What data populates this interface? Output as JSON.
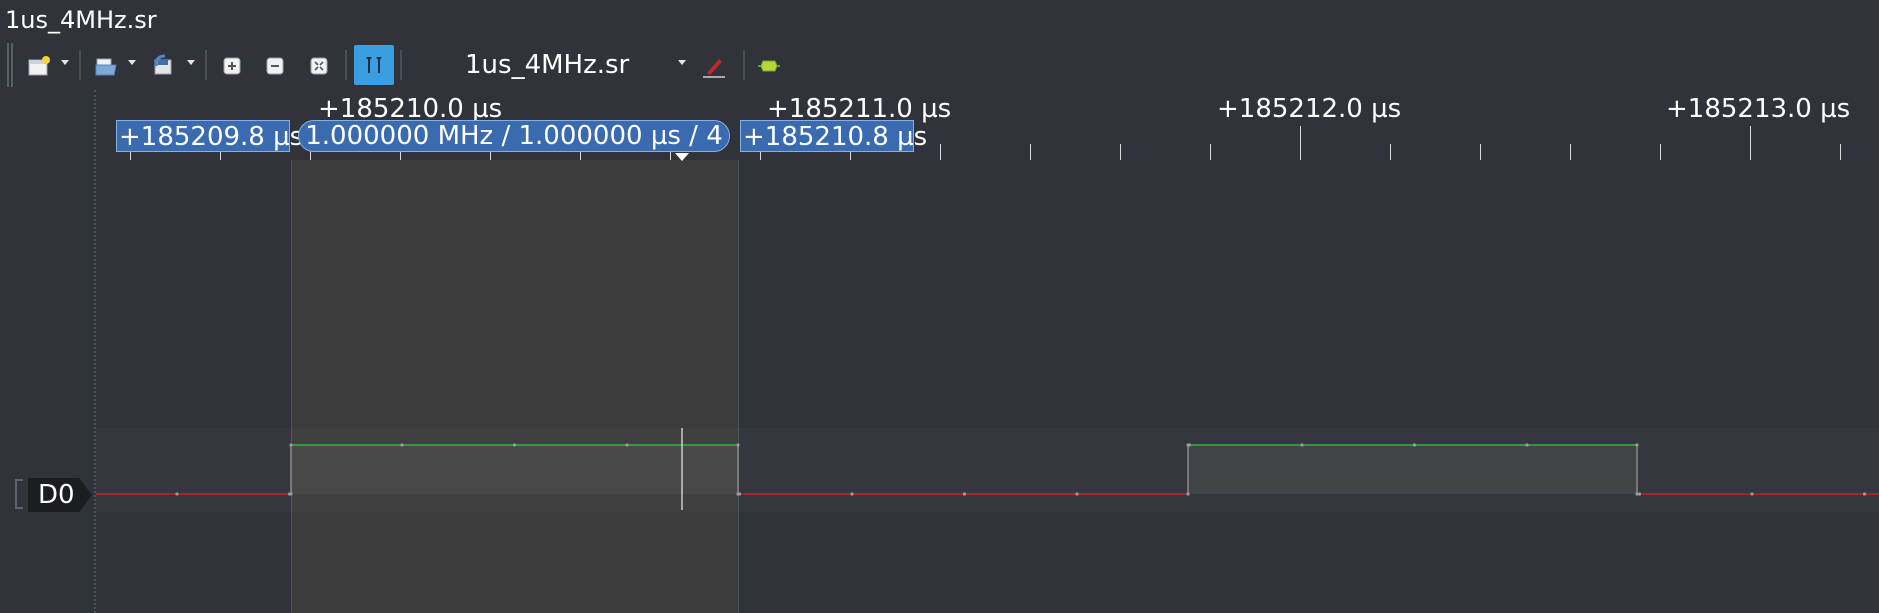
{
  "window": {
    "title": "1us_4MHz.sr"
  },
  "toolbar": {
    "session_name": "1us_4MHz.sr",
    "buttons": [
      {
        "name": "new-session-button",
        "icon": "new-window-icon"
      },
      {
        "name": "open-button",
        "icon": "folder-open-icon"
      },
      {
        "name": "save-button",
        "icon": "save-icon"
      },
      {
        "name": "zoom-in-button",
        "icon": "zoom-in-icon"
      },
      {
        "name": "zoom-out-button",
        "icon": "zoom-out-icon"
      },
      {
        "name": "zoom-fit-button",
        "icon": "zoom-fit-icon"
      },
      {
        "name": "cursors-toggle-button",
        "icon": "cursors-icon",
        "active": true
      },
      {
        "name": "device-config-button",
        "icon": "probe-icon"
      },
      {
        "name": "add-decoder-button",
        "icon": "decoder-icon"
      }
    ],
    "accent": "#3a9ee0"
  },
  "ruler": {
    "major_labels": [
      "+185210.0 µs",
      "+185211.0 µs",
      "+185212.0 µs",
      "+185213.0 µs"
    ],
    "cursor_left": "+185209.8 µs",
    "cursor_right": "+185210.8 µs",
    "cursor_pair": "1.000000 MHz / 1.000000 µs / 4"
  },
  "trace": {
    "channel_label": "D0",
    "high_color": "#2fb53c",
    "low_color": "#c0232c",
    "samples": [
      0,
      0,
      1,
      1,
      1,
      1,
      0,
      0,
      0,
      0,
      1,
      1,
      1,
      1,
      0,
      0,
      0,
      0
    ]
  }
}
